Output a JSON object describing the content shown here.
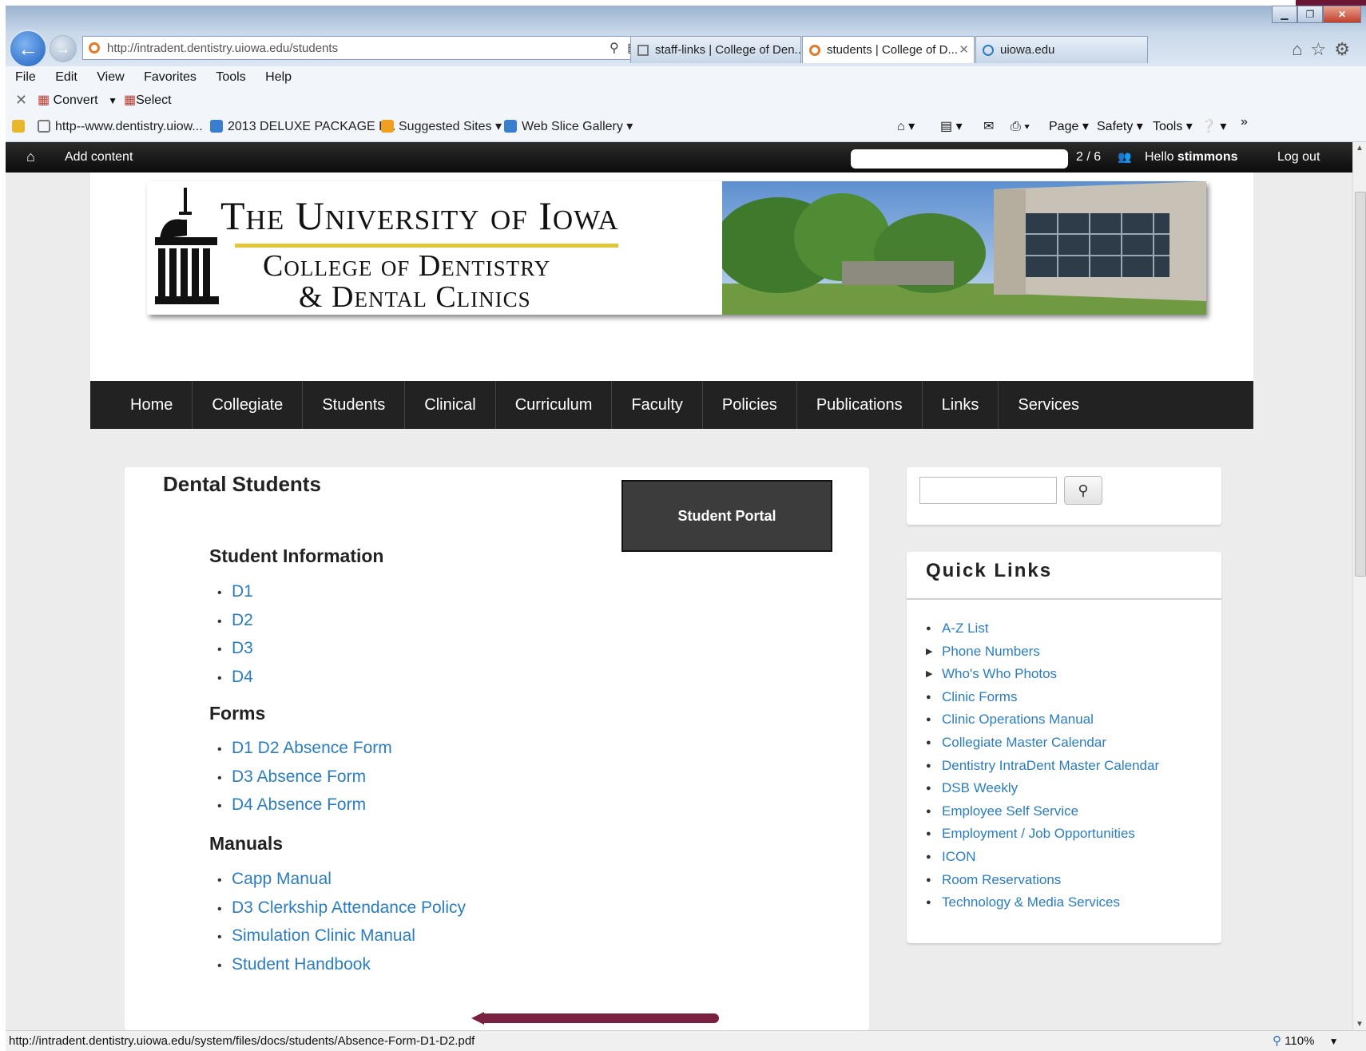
{
  "browser": {
    "address_url": "http://intradent.dentistry.uiowa.edu/students",
    "tabs": [
      {
        "label": "staff-links | College of Den...",
        "active": false
      },
      {
        "label": "students | College of D...",
        "active": true
      },
      {
        "label": "uiowa.edu",
        "active": false
      }
    ],
    "window_buttons": {
      "minimize": "▁",
      "restore": "❐",
      "close": "✕"
    },
    "menu": [
      "File",
      "Edit",
      "View",
      "Favorites",
      "Tools",
      "Help"
    ],
    "command_bar": {
      "convert": "Convert",
      "select": "Select"
    },
    "favorites": {
      "items": [
        "http--www.dentistry.uiow...",
        "2013 DELUXE PACKAGE F...",
        "Suggested Sites ▾",
        "Web Slice Gallery ▾"
      ]
    },
    "favorites_tools": [
      "Page ▾",
      "Safety ▾",
      "Tools ▾"
    ],
    "status_url": "http://intradent.dentistry.uiowa.edu/system/files/docs/students/Absence-Form-D1-D2.pdf",
    "zoom": "110%"
  },
  "admin_bar": {
    "add_content": "Add content",
    "count": "2 / 6",
    "hello_prefix": "Hello",
    "username": "stimmons",
    "logout": "Log out"
  },
  "header": {
    "line1": "The University of Iowa",
    "line2": "College of Dentistry",
    "line3": "& Dental Clinics"
  },
  "nav": [
    "Home",
    "Collegiate",
    "Students",
    "Clinical",
    "Curriculum",
    "Faculty",
    "Policies",
    "Publications",
    "Links",
    "Services"
  ],
  "main": {
    "title": "Dental Students",
    "portal_button": "Student Portal",
    "sections": [
      {
        "heading": "Student Information",
        "items": [
          "D1",
          "D2",
          "D3",
          "D4"
        ]
      },
      {
        "heading": "Forms",
        "items": [
          "D1 D2 Absence Form",
          "D3 Absence Form",
          "D4 Absence Form"
        ]
      },
      {
        "heading": "Manuals",
        "items": [
          "Capp Manual",
          "D3 Clerkship Attendance Policy",
          "Simulation Clinic Manual",
          "Student Handbook"
        ]
      }
    ]
  },
  "sidebar": {
    "quick_links_title": "Quick Links",
    "quick_links": [
      {
        "label": "A-Z List",
        "bullet": "●"
      },
      {
        "label": "Phone Numbers",
        "bullet": "▶"
      },
      {
        "label": "Who's Who Photos",
        "bullet": "▶"
      },
      {
        "label": "Clinic Forms",
        "bullet": "●"
      },
      {
        "label": "Clinic Operations Manual",
        "bullet": "●"
      },
      {
        "label": "Collegiate Master Calendar",
        "bullet": "●"
      },
      {
        "label": "Dentistry IntraDent Master Calendar",
        "bullet": "●"
      },
      {
        "label": "DSB Weekly",
        "bullet": "●"
      },
      {
        "label": "Employee Self Service",
        "bullet": "●"
      },
      {
        "label": "Employment / Job Opportunities",
        "bullet": "●"
      },
      {
        "label": "ICON",
        "bullet": "●"
      },
      {
        "label": "Room Reservations",
        "bullet": "●"
      },
      {
        "label": "Technology & Media Services",
        "bullet": "●"
      }
    ]
  },
  "colors": {
    "link": "#2a7dc0",
    "nav_bg": "#222222",
    "arrow": "#7a2040",
    "accent_gold": "#e3c53a"
  }
}
